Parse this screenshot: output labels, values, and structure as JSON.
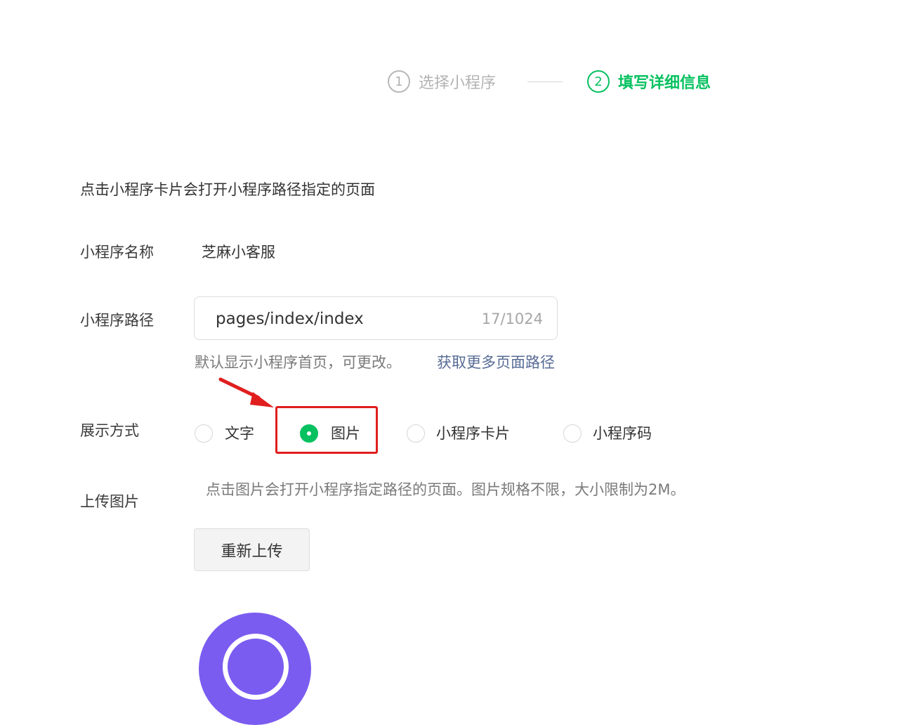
{
  "steps": [
    {
      "number": "1",
      "label": "选择小程序"
    },
    {
      "number": "2",
      "label": "填写详细信息"
    }
  ],
  "intro_text": "点击小程序卡片会打开小程序路径指定的页面",
  "mini_program_name": {
    "label": "小程序名称",
    "value": "芝麻小客服"
  },
  "mini_program_path": {
    "label": "小程序路径",
    "value": "pages/index/index",
    "count": "17/1024",
    "hint": "默认显示小程序首页，可更改。",
    "link": "获取更多页面路径"
  },
  "display_mode": {
    "label": "展示方式",
    "options": [
      {
        "label": "文字",
        "checked": false
      },
      {
        "label": "图片",
        "checked": true
      },
      {
        "label": "小程序卡片",
        "checked": false
      },
      {
        "label": "小程序码",
        "checked": false
      }
    ]
  },
  "upload_image": {
    "label": "上传图片",
    "hint": "点击图片会打开小程序指定路径的页面。图片规格不限，大小限制为2M。",
    "button_label": "重新上传"
  },
  "colors": {
    "accent": "#07c160",
    "link": "#576b95",
    "annotation": "#e01e1e",
    "preview": "#7b5cf0"
  }
}
